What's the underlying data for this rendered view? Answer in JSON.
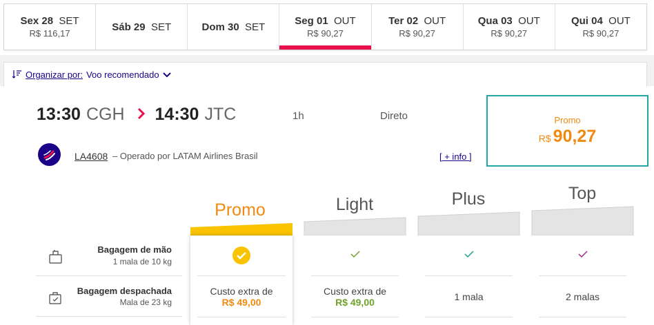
{
  "date_tabs": [
    {
      "day": "Sex 28",
      "month": "SET",
      "price": "R$ 116,17",
      "selected": false
    },
    {
      "day": "Sáb 29",
      "month": "SET",
      "price": "",
      "selected": false
    },
    {
      "day": "Dom 30",
      "month": "SET",
      "price": "",
      "selected": false
    },
    {
      "day": "Seg 01",
      "month": "OUT",
      "price": "R$ 90,27",
      "selected": true
    },
    {
      "day": "Ter 02",
      "month": "OUT",
      "price": "R$ 90,27",
      "selected": false
    },
    {
      "day": "Qua 03",
      "month": "OUT",
      "price": "R$ 90,27",
      "selected": false
    },
    {
      "day": "Qui 04",
      "month": "OUT",
      "price": "R$ 90,27",
      "selected": false
    }
  ],
  "sort": {
    "label": "Organizar por:",
    "value": "Voo recomendado"
  },
  "flight": {
    "depart_time": "13:30",
    "depart_airport": "CGH",
    "arrive_time": "14:30",
    "arrive_airport": "JTC",
    "duration": "1h",
    "stops": "Direto",
    "flight_number": "LA4608",
    "operated_by": "– Operado por LATAM Airlines Brasil",
    "more_info": "[ + info ]"
  },
  "fare_box": {
    "label": "Promo",
    "currency": "R$",
    "amount": "90,27"
  },
  "fare_families": [
    {
      "name": "Promo",
      "name_color": "#f08a10",
      "header_color": "#f9c300"
    },
    {
      "name": "Light",
      "name_color": "#555555",
      "header_color": "#e4e4e4"
    },
    {
      "name": "Plus",
      "name_color": "#555555",
      "header_color": "#e4e4e4"
    },
    {
      "name": "Top",
      "name_color": "#555555",
      "header_color": "#e4e4e4"
    }
  ],
  "features": [
    {
      "title": "Bagagem de mão",
      "subtitle": "1 mala de 10 kg",
      "icon": "carry-on-bag-icon"
    },
    {
      "title": "Bagagem despachada",
      "subtitle": "Mala de 23 kg",
      "icon": "checked-bag-icon"
    }
  ],
  "checked_bag": {
    "promo_text": "Custo extra de",
    "promo_price": "R$ 49,00",
    "light_text": "Custo extra de",
    "light_price": "R$ 49,00",
    "plus_text": "1 mala",
    "top_text": "2 malas"
  },
  "colors": {
    "accent_red": "#e8114b",
    "latam_blue": "#1b0088",
    "promo_orange": "#f08a10",
    "teal_border": "#23a7a2",
    "check_yellow": "#f9c300",
    "check_green": "#6ea12a",
    "check_teal": "#1a9e8f",
    "check_purple": "#a0268a"
  }
}
